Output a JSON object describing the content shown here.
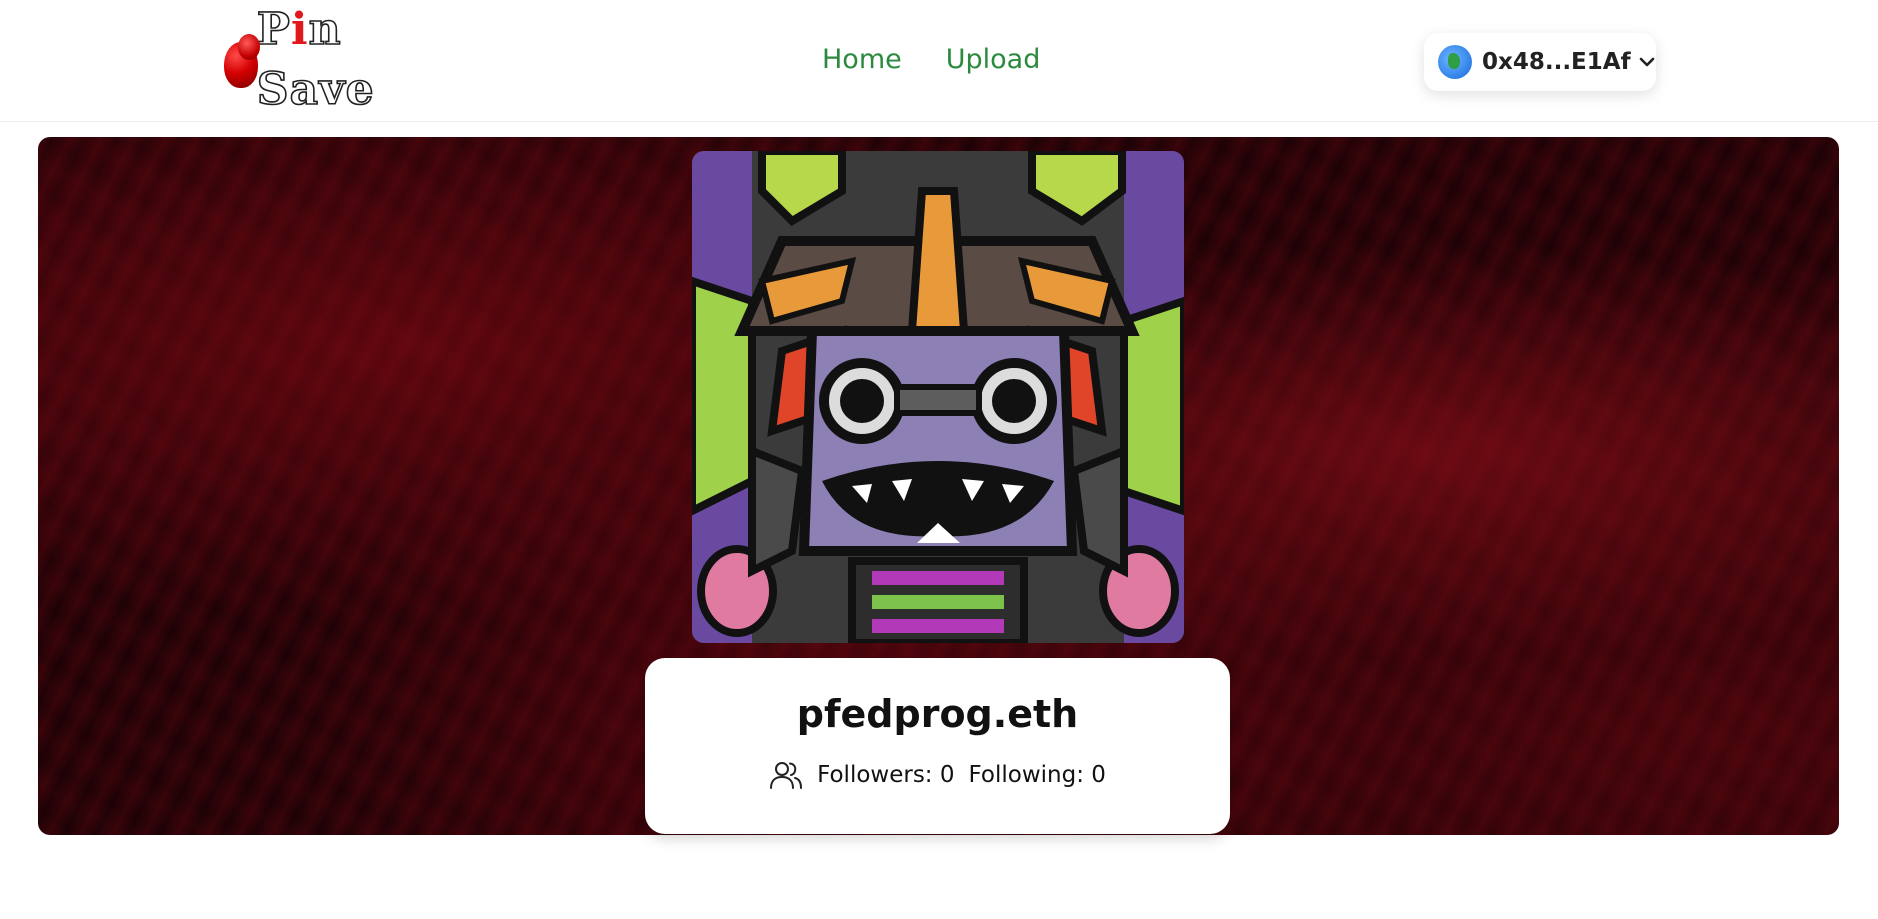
{
  "header": {
    "logo": {
      "text_p": "P",
      "text_i": "i",
      "text_rest": "n Save",
      "alt": "Pin Save"
    },
    "nav": [
      {
        "label": "Home"
      },
      {
        "label": "Upload"
      }
    ],
    "wallet": {
      "address": "0x48...E1Af",
      "icon": "globe-icon"
    }
  },
  "profile": {
    "name": "pfedprog.eth",
    "followers_label": "Followers: 0",
    "following_label": "Following: 0",
    "stats_icon": "users-icon"
  },
  "colors": {
    "nav_link": "#2b8a3e",
    "banner_bg": "#1c0206",
    "accent_red": "#d40000"
  }
}
